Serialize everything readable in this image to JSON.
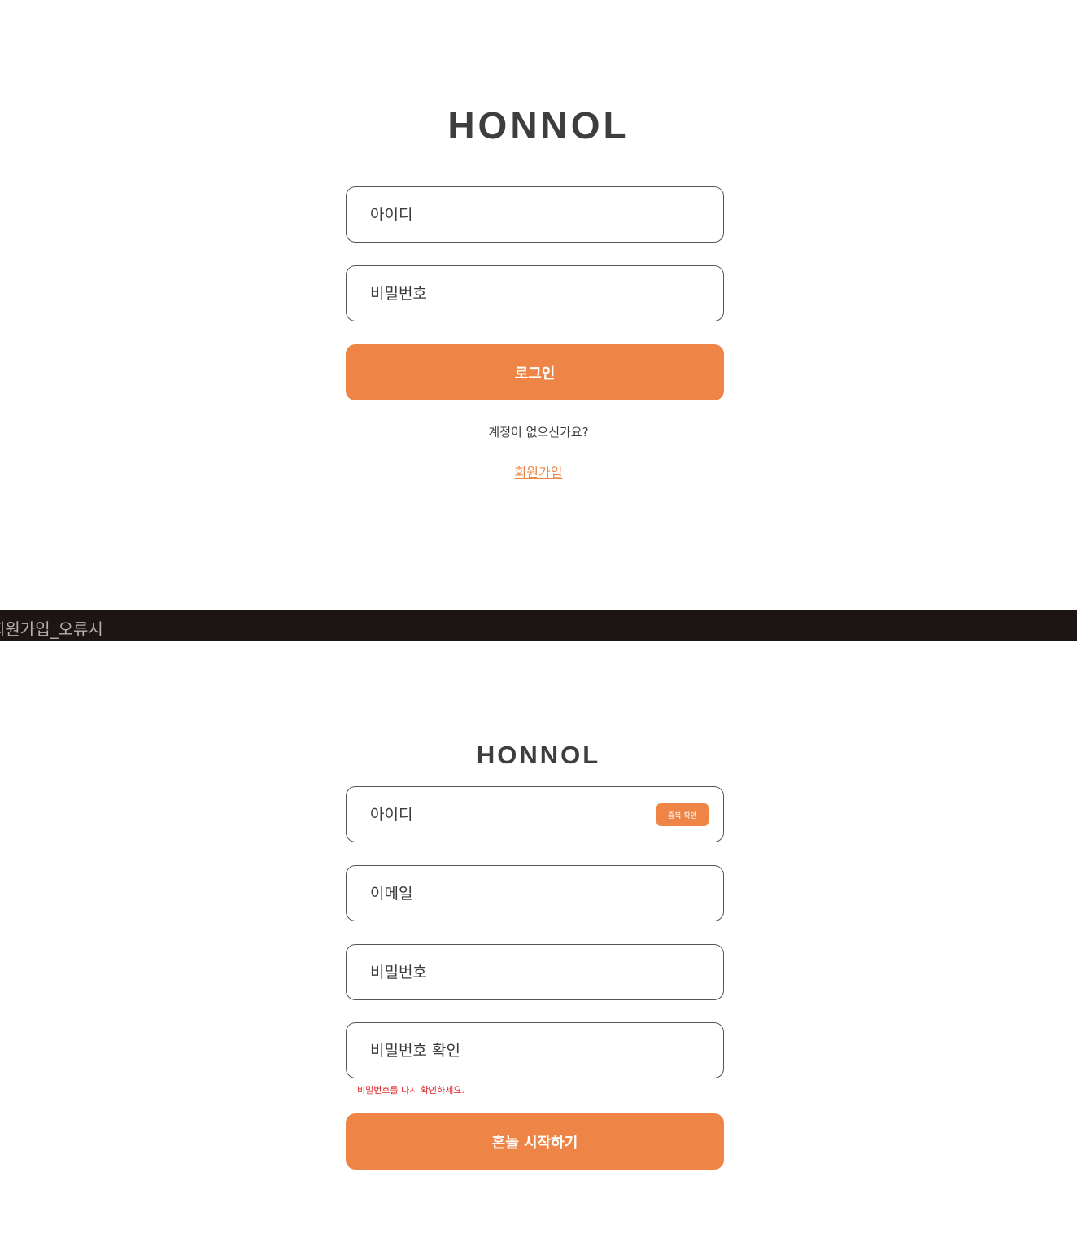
{
  "login": {
    "logo": "HONNOL",
    "id_placeholder": "아이디",
    "password_placeholder": "비밀번호",
    "login_button": "로그인",
    "no_account_text": "계정이 없으신가요?",
    "signup_link": "회원가입"
  },
  "divider": {
    "label": "회원가입_오류시"
  },
  "signup": {
    "logo": "HONNOL",
    "id_placeholder": "아이디",
    "dup_check_button": "중복 확인",
    "email_placeholder": "이메일",
    "password_placeholder": "비밀번호",
    "password_confirm_placeholder": "비밀번호 확인",
    "error_message": "비밀번호를 다시 확인하세요.",
    "start_button": "혼놀 시작하기"
  },
  "colors": {
    "accent": "#ee8546",
    "error": "#e02020",
    "divider": "#1d1414",
    "text": "#3a3a3a"
  }
}
